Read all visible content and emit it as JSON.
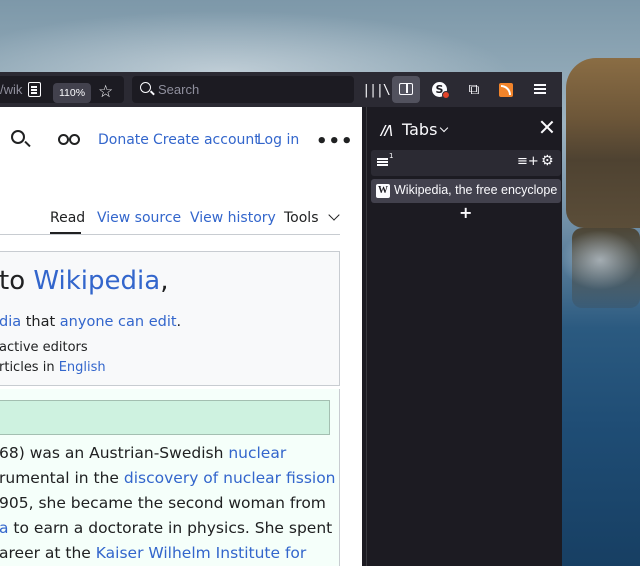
{
  "toolbar": {
    "url_fragment": "/wik",
    "zoom": "110%",
    "search_placeholder": "Search"
  },
  "wikipedia": {
    "header_links": [
      "Donate",
      "Create account",
      "Log in"
    ],
    "page_tabs": [
      "Read",
      "View source",
      "View history",
      "Tools"
    ],
    "welcome": {
      "title_prefix": "to ",
      "title_link": "Wikipedia",
      "title_suffix": ",",
      "line2_link1": "dia",
      "line2_text": " that ",
      "line2_link2": "anyone can edit",
      "line2_end": ".",
      "line3": "active editors",
      "line4_text": "rticles in ",
      "line4_link": "English"
    },
    "featured": {
      "l1_text": "68) was an Austrian-Swedish ",
      "l1_link": "nuclear",
      "l2_text": "rumental in the ",
      "l2_link": "discovery of nuclear fission",
      "l3_text": "905, she became the second woman from",
      "l4_link": "a",
      "l4_text": " to earn a doctorate in physics. She spent",
      "l5_text": "areer at the ",
      "l5_link": "Kaiser Wilhelm Institute for"
    }
  },
  "sidebar": {
    "title": "Tabs",
    "tab_count": "1",
    "tabs": [
      {
        "title": "Wikipedia, the free encyclope",
        "favicon": "W"
      }
    ],
    "add_label": "+"
  },
  "colors": {
    "link": "#3366cc",
    "toolbar_bg": "#2b2a33",
    "sidebar_bg": "#1c1b22"
  }
}
